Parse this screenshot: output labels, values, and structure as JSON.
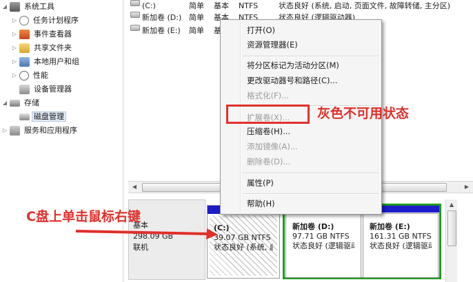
{
  "tree": {
    "items": [
      {
        "label": "系统工具",
        "level": 0,
        "expander": "collapse"
      },
      {
        "label": "任务计划程序",
        "level": 1,
        "expander": "expand"
      },
      {
        "label": "事件查看器",
        "level": 1,
        "expander": "expand"
      },
      {
        "label": "共享文件夹",
        "level": 1,
        "expander": "expand"
      },
      {
        "label": "本地用户和组",
        "level": 1,
        "expander": "expand"
      },
      {
        "label": "性能",
        "level": 1,
        "expander": "expand"
      },
      {
        "label": "设备管理器",
        "level": 1,
        "expander": "none"
      },
      {
        "label": "存储",
        "level": 0,
        "expander": "collapse"
      },
      {
        "label": "磁盘管理",
        "level": 1,
        "expander": "none",
        "selected": true
      },
      {
        "label": "服务和应用程序",
        "level": 0,
        "expander": "expand"
      }
    ]
  },
  "volumes": {
    "rows": [
      {
        "name": "(C:)",
        "layout": "简单",
        "type": "基本",
        "fs": "NTFS",
        "status": "状态良好 (系统, 启动, 页面文件, 故障转储, 主分区)"
      },
      {
        "name": "新加卷 (D:)",
        "layout": "简单",
        "type": "基本",
        "fs": "NTFS",
        "status": "状态良好 (逻辑驱动器)"
      },
      {
        "name": "新加卷 (E:)",
        "layout": "简单",
        "type": "基本",
        "fs": "",
        "status": ""
      }
    ]
  },
  "disk": {
    "title": "基本",
    "size": "298.09 GB",
    "state": "联机",
    "partitions": [
      {
        "name": "(C:)",
        "size": "39.07 GB NTFS",
        "status": "状态良好 (系统, 启"
      },
      {
        "name": "新加卷  (D:)",
        "size": "97.71 GB NTFS",
        "status": "状态良好 (逻辑驱动器)"
      },
      {
        "name": "新加卷  (E:)",
        "size": "161.31 GB NTFS",
        "status": "状态良好 (逻辑驱动器)"
      }
    ]
  },
  "context_menu": {
    "items": [
      {
        "label": "打开(O)",
        "enabled": true
      },
      {
        "label": "资源管理器(E)",
        "enabled": true
      },
      {
        "label": "将分区标记为活动分区(M)",
        "enabled": true
      },
      {
        "label": "更改驱动器号和路径(C)...",
        "enabled": true
      },
      {
        "label": "格式化(F)...",
        "enabled": false
      },
      {
        "label": "扩展卷(X)...",
        "enabled": false
      },
      {
        "label": "压缩卷(H)...",
        "enabled": true
      },
      {
        "label": "添加镜像(A)...",
        "enabled": false
      },
      {
        "label": "删除卷(D)...",
        "enabled": false
      },
      {
        "label": "属性(P)",
        "enabled": true
      },
      {
        "label": "帮助(H)",
        "enabled": true
      }
    ]
  },
  "annotations": {
    "gray_state": "灰色不可用状态",
    "right_click_hint": "C盘上单击鼠标右键"
  },
  "colors": {
    "annotation_red": "#e0302b",
    "primary_bar": "#1c1cc8",
    "extended_frame": "#1f9a1f"
  }
}
